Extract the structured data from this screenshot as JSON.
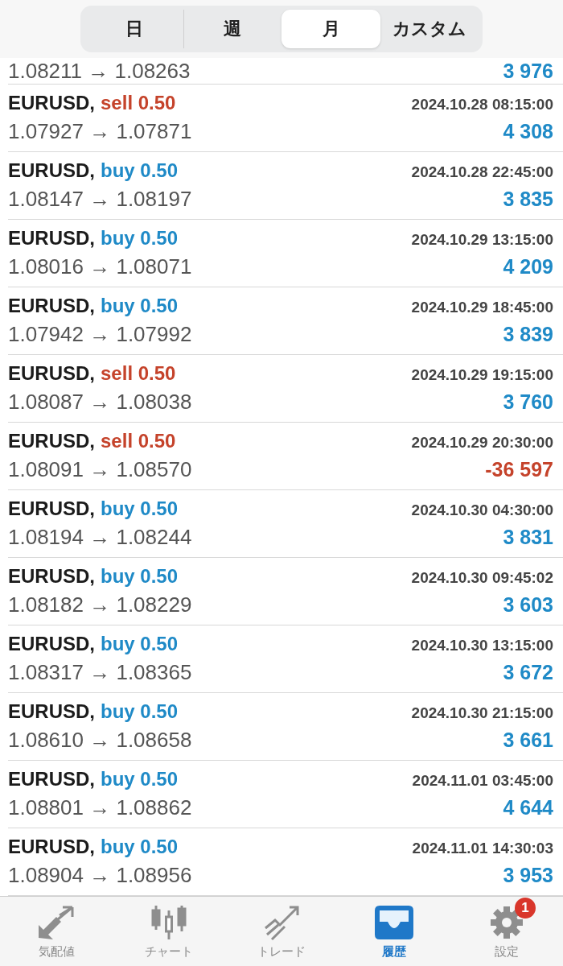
{
  "periods": [
    {
      "label": "日",
      "selected": false
    },
    {
      "label": "週",
      "selected": false
    },
    {
      "label": "月",
      "selected": true
    },
    {
      "label": "カスタム",
      "selected": false
    }
  ],
  "partial_row": {
    "prices": "1.08211 → 1.08263",
    "profit": "3 976",
    "loss": false
  },
  "deals": [
    {
      "symbol": "EURUSD,",
      "kind": "sell",
      "volume": "sell 0.50",
      "time": "2024.10.28 08:15:00",
      "prices": "1.07927 → 1.07871",
      "profit": "4 308",
      "loss": false
    },
    {
      "symbol": "EURUSD,",
      "kind": "buy",
      "volume": "buy 0.50",
      "time": "2024.10.28 22:45:00",
      "prices": "1.08147 → 1.08197",
      "profit": "3 835",
      "loss": false
    },
    {
      "symbol": "EURUSD,",
      "kind": "buy",
      "volume": "buy 0.50",
      "time": "2024.10.29 13:15:00",
      "prices": "1.08016 → 1.08071",
      "profit": "4 209",
      "loss": false
    },
    {
      "symbol": "EURUSD,",
      "kind": "buy",
      "volume": "buy 0.50",
      "time": "2024.10.29 18:45:00",
      "prices": "1.07942 → 1.07992",
      "profit": "3 839",
      "loss": false
    },
    {
      "symbol": "EURUSD,",
      "kind": "sell",
      "volume": "sell 0.50",
      "time": "2024.10.29 19:15:00",
      "prices": "1.08087 → 1.08038",
      "profit": "3 760",
      "loss": false
    },
    {
      "symbol": "EURUSD,",
      "kind": "sell",
      "volume": "sell 0.50",
      "time": "2024.10.29 20:30:00",
      "prices": "1.08091 → 1.08570",
      "profit": "-36 597",
      "loss": true
    },
    {
      "symbol": "EURUSD,",
      "kind": "buy",
      "volume": "buy 0.50",
      "time": "2024.10.30 04:30:00",
      "prices": "1.08194 → 1.08244",
      "profit": "3 831",
      "loss": false
    },
    {
      "symbol": "EURUSD,",
      "kind": "buy",
      "volume": "buy 0.50",
      "time": "2024.10.30 09:45:02",
      "prices": "1.08182 → 1.08229",
      "profit": "3 603",
      "loss": false
    },
    {
      "symbol": "EURUSD,",
      "kind": "buy",
      "volume": "buy 0.50",
      "time": "2024.10.30 13:15:00",
      "prices": "1.08317 → 1.08365",
      "profit": "3 672",
      "loss": false
    },
    {
      "symbol": "EURUSD,",
      "kind": "buy",
      "volume": "buy 0.50",
      "time": "2024.10.30 21:15:00",
      "prices": "1.08610 → 1.08658",
      "profit": "3 661",
      "loss": false
    },
    {
      "symbol": "EURUSD,",
      "kind": "buy",
      "volume": "buy 0.50",
      "time": "2024.11.01 03:45:00",
      "prices": "1.08801 → 1.08862",
      "profit": "4 644",
      "loss": false
    },
    {
      "symbol": "EURUSD,",
      "kind": "buy",
      "volume": "buy 0.50",
      "time": "2024.11.01 14:30:03",
      "prices": "1.08904 → 1.08956",
      "profit": "3 953",
      "loss": false
    }
  ],
  "tabs": [
    {
      "kind": "quotes",
      "label": "気配値",
      "selected": false
    },
    {
      "kind": "chart",
      "label": "チャート",
      "selected": false
    },
    {
      "kind": "trade",
      "label": "トレード",
      "selected": false
    },
    {
      "kind": "history",
      "label": "履歴",
      "selected": true
    },
    {
      "kind": "settings",
      "label": "設定",
      "selected": false,
      "badge": "1"
    }
  ]
}
